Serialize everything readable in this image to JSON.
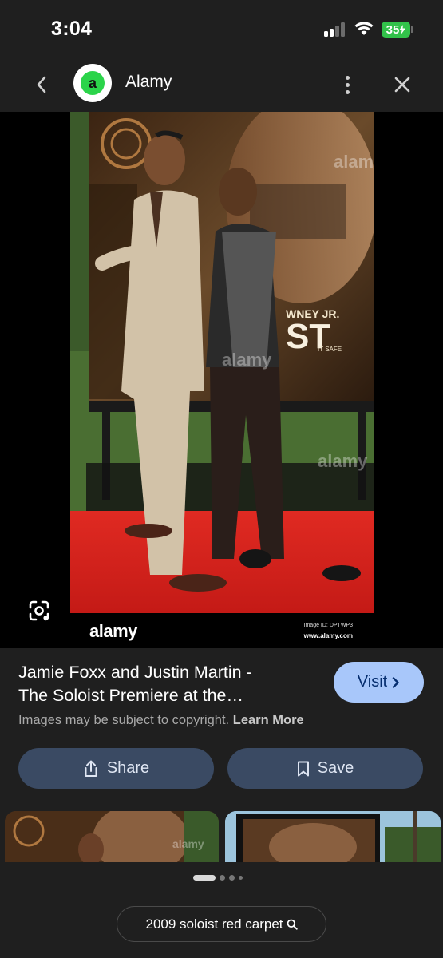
{
  "status_bar": {
    "time": "3:04",
    "battery": "35"
  },
  "header": {
    "site_logo_letter": "a",
    "site_name": "Alamy"
  },
  "photo": {
    "watermark_logo": "alamy",
    "image_id": "Image ID: DPTWP3",
    "image_url": "www.alamy.com",
    "poster_text_1": "WNEY JR.",
    "poster_text_2": "ST",
    "poster_text_3": "IT SAFE"
  },
  "result": {
    "title_line1": "Jamie Foxx and Justin Martin -",
    "title_line2": "The Soloist Premiere at the…",
    "visit_label": "Visit",
    "copyright_text": "Images may be subject to copyright.",
    "learn_more": "Learn More"
  },
  "actions": {
    "share_label": "Share",
    "save_label": "Save"
  },
  "thumbnails": {
    "watermark": "alamy"
  },
  "search_suggestion": "2009 soloist red carpet",
  "colors": {
    "background": "#1f1f1f",
    "visit_button": "#a8c7fa",
    "action_button": "#3a4a63",
    "battery": "#32c24a",
    "site_logo": "#2bd44a",
    "red_carpet": "#d42020"
  }
}
